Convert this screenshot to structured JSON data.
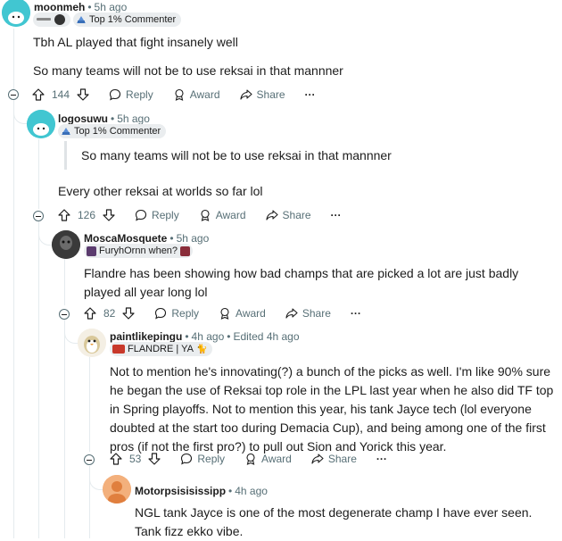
{
  "comments": [
    {
      "author": "moonmeh",
      "time": "5h ago",
      "flair": "Top 1% Commenter",
      "body": [
        "Tbh AL played that fight insanely well",
        "So many teams will not be to use reksai in that mannner"
      ],
      "score": "144"
    },
    {
      "author": "logosuwu",
      "time": "5h ago",
      "flair": "Top 1% Commenter",
      "quote": "So many teams will not be to use reksai in that mannner",
      "body": [
        "Every other reksai at worlds so far lol"
      ],
      "score": "126"
    },
    {
      "author": "MoscaMosquete",
      "time": "5h ago",
      "flair": "FuryhOrnn when?",
      "body": [
        "Flandre has been showing how bad champs that are picked a lot are just badly played all year long lol"
      ],
      "score": "82"
    },
    {
      "author": "paintlikepingu",
      "time": "4h ago",
      "edited": "Edited 4h ago",
      "flair": "FLANDRE | YA",
      "body": [
        "Not to mention he's innovating(?) a bunch of the picks as well. I'm like 90% sure he began the use of Reksai top role in the LPL last year when he also did TF top in Spring playoffs. Not to mention this year, his tank Jayce tech (lol everyone doubted at the start too during Demacia Cup), and being among one of the first pros (if not the first pro?) to pull out Sion and Yorick this year."
      ],
      "score": "53"
    },
    {
      "author": "Motorpsisisissipp",
      "time": "4h ago",
      "body": [
        "NGL tank Jayce is one of the most degenerate champ I have ever seen. Tank fizz ekko vibe."
      ]
    }
  ],
  "actions": {
    "reply": "Reply",
    "award": "Award",
    "share": "Share",
    "more": "···"
  },
  "colors": {
    "muted": "#576f76",
    "line": "#e5ebee",
    "flair_bg": "#eaedef",
    "accent_teal": "#41c6d1"
  }
}
